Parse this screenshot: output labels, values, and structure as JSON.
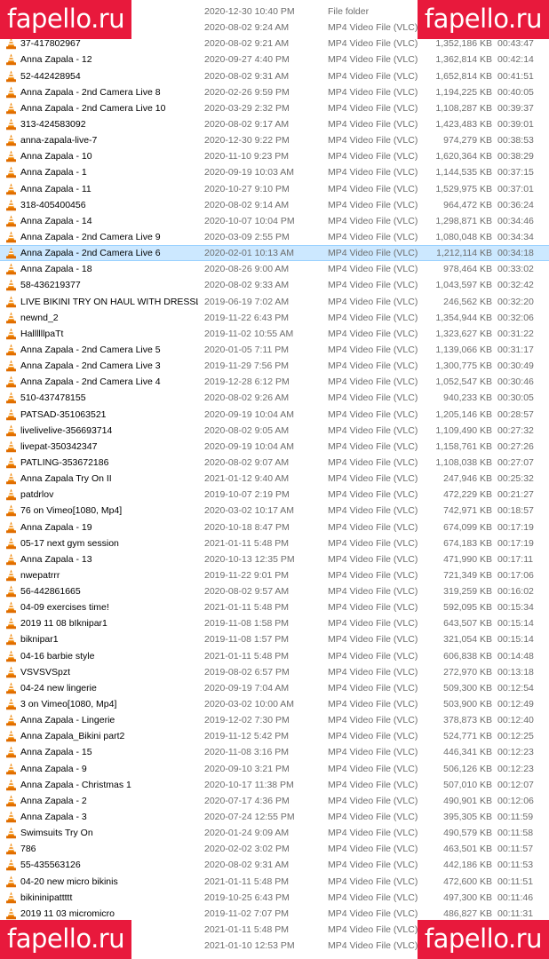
{
  "watermark": "fapello.ru",
  "rows": [
    {
      "name": "",
      "date": "2020-12-30 10:40 PM",
      "type": "File folder",
      "size": "",
      "length": "",
      "folder": true
    },
    {
      "name": "",
      "date": "2020-08-02 9:24 AM",
      "type": "MP4 Video File (VLC)",
      "size": "",
      "length": ""
    },
    {
      "name": "37-417802967",
      "date": "2020-08-02 9:21 AM",
      "type": "MP4 Video File (VLC)",
      "size": "1,352,186 KB",
      "length": "00:43:47"
    },
    {
      "name": "Anna Zapala - 12",
      "date": "2020-09-27 4:40 PM",
      "type": "MP4 Video File (VLC)",
      "size": "1,362,814 KB",
      "length": "00:42:14"
    },
    {
      "name": "52-442428954",
      "date": "2020-08-02 9:31 AM",
      "type": "MP4 Video File (VLC)",
      "size": "1,652,814 KB",
      "length": "00:41:51"
    },
    {
      "name": "Anna Zapala - 2nd Camera Live 8",
      "date": "2020-02-26 9:59 PM",
      "type": "MP4 Video File (VLC)",
      "size": "1,194,225 KB",
      "length": "00:40:05"
    },
    {
      "name": "Anna Zapala - 2nd Camera Live 10",
      "date": "2020-03-29 2:32 PM",
      "type": "MP4 Video File (VLC)",
      "size": "1,108,287 KB",
      "length": "00:39:37"
    },
    {
      "name": "313-424583092",
      "date": "2020-08-02 9:17 AM",
      "type": "MP4 Video File (VLC)",
      "size": "1,423,483 KB",
      "length": "00:39:01"
    },
    {
      "name": "anna-zapala-live-7",
      "date": "2020-12-30 9:22 PM",
      "type": "MP4 Video File (VLC)",
      "size": "974,279 KB",
      "length": "00:38:53"
    },
    {
      "name": "Anna Zapala - 10",
      "date": "2020-11-10 9:23 PM",
      "type": "MP4 Video File (VLC)",
      "size": "1,620,364 KB",
      "length": "00:38:29"
    },
    {
      "name": "Anna Zapala - 1",
      "date": "2020-09-19 10:03 AM",
      "type": "MP4 Video File (VLC)",
      "size": "1,144,535 KB",
      "length": "00:37:15"
    },
    {
      "name": "Anna Zapala - 11",
      "date": "2020-10-27 9:10 PM",
      "type": "MP4 Video File (VLC)",
      "size": "1,529,975 KB",
      "length": "00:37:01"
    },
    {
      "name": "318-405400456",
      "date": "2020-08-02 9:14 AM",
      "type": "MP4 Video File (VLC)",
      "size": "964,472 KB",
      "length": "00:36:24"
    },
    {
      "name": "Anna Zapala - 14",
      "date": "2020-10-07 10:04 PM",
      "type": "MP4 Video File (VLC)",
      "size": "1,298,871 KB",
      "length": "00:34:46"
    },
    {
      "name": "Anna Zapala - 2nd Camera Live 9",
      "date": "2020-03-09 2:55 PM",
      "type": "MP4 Video File (VLC)",
      "size": "1,080,048 KB",
      "length": "00:34:34"
    },
    {
      "name": "Anna Zapala - 2nd Camera Live 6",
      "date": "2020-02-01 10:13 AM",
      "type": "MP4 Video File (VLC)",
      "size": "1,212,114 KB",
      "length": "00:34:18",
      "selected": true
    },
    {
      "name": "Anna Zapala - 18",
      "date": "2020-08-26 9:00 AM",
      "type": "MP4 Video File (VLC)",
      "size": "978,464 KB",
      "length": "00:33:02"
    },
    {
      "name": "58-436219377",
      "date": "2020-08-02 9:33 AM",
      "type": "MP4 Video File (VLC)",
      "size": "1,043,597 KB",
      "length": "00:32:42"
    },
    {
      "name": "LIVE  BIKINI TRY ON HAUL WITH DRESSLI...",
      "date": "2019-06-19 7:02 AM",
      "type": "MP4 Video File (VLC)",
      "size": "246,562 KB",
      "length": "00:32:20"
    },
    {
      "name": "newnd_2",
      "date": "2019-11-22 6:43 PM",
      "type": "MP4 Video File (VLC)",
      "size": "1,354,944 KB",
      "length": "00:32:06"
    },
    {
      "name": "HallllllpaTt",
      "date": "2019-11-02 10:55 AM",
      "type": "MP4 Video File (VLC)",
      "size": "1,323,627 KB",
      "length": "00:31:22"
    },
    {
      "name": "Anna Zapala - 2nd Camera Live 5",
      "date": "2020-01-05 7:11 PM",
      "type": "MP4 Video File (VLC)",
      "size": "1,139,066 KB",
      "length": "00:31:17"
    },
    {
      "name": "Anna Zapala - 2nd Camera Live 3",
      "date": "2019-11-29 7:56 PM",
      "type": "MP4 Video File (VLC)",
      "size": "1,300,775 KB",
      "length": "00:30:49"
    },
    {
      "name": "Anna Zapala - 2nd Camera Live 4",
      "date": "2019-12-28 6:12 PM",
      "type": "MP4 Video File (VLC)",
      "size": "1,052,547 KB",
      "length": "00:30:46"
    },
    {
      "name": "510-437478155",
      "date": "2020-08-02 9:26 AM",
      "type": "MP4 Video File (VLC)",
      "size": "940,233 KB",
      "length": "00:30:05"
    },
    {
      "name": "PATSAD-351063521",
      "date": "2020-09-19 10:04 AM",
      "type": "MP4 Video File (VLC)",
      "size": "1,205,146 KB",
      "length": "00:28:57"
    },
    {
      "name": "livelivelive-356693714",
      "date": "2020-08-02 9:05 AM",
      "type": "MP4 Video File (VLC)",
      "size": "1,109,490 KB",
      "length": "00:27:32"
    },
    {
      "name": "livepat-350342347",
      "date": "2020-09-19 10:04 AM",
      "type": "MP4 Video File (VLC)",
      "size": "1,158,761 KB",
      "length": "00:27:26"
    },
    {
      "name": "PATLING-353672186",
      "date": "2020-08-02 9:07 AM",
      "type": "MP4 Video File (VLC)",
      "size": "1,108,038 KB",
      "length": "00:27:07"
    },
    {
      "name": "Anna Zapala Try On II",
      "date": "2021-01-12 9:40 AM",
      "type": "MP4 Video File (VLC)",
      "size": "247,946 KB",
      "length": "00:25:32"
    },
    {
      "name": "patdrlov",
      "date": "2019-10-07 2:19 PM",
      "type": "MP4 Video File (VLC)",
      "size": "472,229 KB",
      "length": "00:21:27"
    },
    {
      "name": "76 on Vimeo[1080, Mp4]",
      "date": "2020-03-02 10:17 AM",
      "type": "MP4 Video File (VLC)",
      "size": "742,971 KB",
      "length": "00:18:57"
    },
    {
      "name": "Anna Zapala - 19",
      "date": "2020-10-18 8:47 PM",
      "type": "MP4 Video File (VLC)",
      "size": "674,099 KB",
      "length": "00:17:19"
    },
    {
      "name": "05-17 next gym session",
      "date": "2021-01-11 5:48 PM",
      "type": "MP4 Video File (VLC)",
      "size": "674,183 KB",
      "length": "00:17:19"
    },
    {
      "name": "Anna Zapala - 13",
      "date": "2020-10-13 12:35 PM",
      "type": "MP4 Video File (VLC)",
      "size": "471,990 KB",
      "length": "00:17:11"
    },
    {
      "name": "nwepatrrr",
      "date": "2019-11-22 9:01 PM",
      "type": "MP4 Video File (VLC)",
      "size": "721,349 KB",
      "length": "00:17:06"
    },
    {
      "name": "56-442861665",
      "date": "2020-08-02 9:57 AM",
      "type": "MP4 Video File (VLC)",
      "size": "319,259 KB",
      "length": "00:16:02"
    },
    {
      "name": "04-09 exercises time!",
      "date": "2021-01-11 5:48 PM",
      "type": "MP4 Video File (VLC)",
      "size": "592,095 KB",
      "length": "00:15:34"
    },
    {
      "name": "2019 11 08 bIknipar1",
      "date": "2019-11-08 1:58 PM",
      "type": "MP4 Video File (VLC)",
      "size": "643,507 KB",
      "length": "00:15:14"
    },
    {
      "name": "biknipar1",
      "date": "2019-11-08 1:57 PM",
      "type": "MP4 Video File (VLC)",
      "size": "321,054 KB",
      "length": "00:15:14"
    },
    {
      "name": "04-16 barbie style",
      "date": "2021-01-11 5:48 PM",
      "type": "MP4 Video File (VLC)",
      "size": "606,838 KB",
      "length": "00:14:48"
    },
    {
      "name": "VSVSVSpzt",
      "date": "2019-08-02 6:57 PM",
      "type": "MP4 Video File (VLC)",
      "size": "272,970 KB",
      "length": "00:13:18"
    },
    {
      "name": "04-24 new lingerie",
      "date": "2020-09-19 7:04 AM",
      "type": "MP4 Video File (VLC)",
      "size": "509,300 KB",
      "length": "00:12:54"
    },
    {
      "name": "3 on Vimeo[1080, Mp4]",
      "date": "2020-03-02 10:00 AM",
      "type": "MP4 Video File (VLC)",
      "size": "503,900 KB",
      "length": "00:12:49"
    },
    {
      "name": "Anna Zapala - Lingerie",
      "date": "2019-12-02 7:30 PM",
      "type": "MP4 Video File (VLC)",
      "size": "378,873 KB",
      "length": "00:12:40"
    },
    {
      "name": "Anna Zapala_Bikini part2",
      "date": "2019-11-12 5:42 PM",
      "type": "MP4 Video File (VLC)",
      "size": "524,771 KB",
      "length": "00:12:25"
    },
    {
      "name": "Anna Zapala - 15",
      "date": "2020-11-08 3:16 PM",
      "type": "MP4 Video File (VLC)",
      "size": "446,341 KB",
      "length": "00:12:23"
    },
    {
      "name": "Anna Zapala - 9",
      "date": "2020-09-10 3:21 PM",
      "type": "MP4 Video File (VLC)",
      "size": "506,126 KB",
      "length": "00:12:23"
    },
    {
      "name": "Anna Zapala - Christmas 1",
      "date": "2020-10-17 11:38 PM",
      "type": "MP4 Video File (VLC)",
      "size": "507,010 KB",
      "length": "00:12:07"
    },
    {
      "name": "Anna Zapala - 2",
      "date": "2020-07-17 4:36 PM",
      "type": "MP4 Video File (VLC)",
      "size": "490,901 KB",
      "length": "00:12:06"
    },
    {
      "name": "Anna Zapala - 3",
      "date": "2020-07-24 12:55 PM",
      "type": "MP4 Video File (VLC)",
      "size": "395,305 KB",
      "length": "00:11:59"
    },
    {
      "name": "Swimsuits Try On",
      "date": "2020-01-24 9:09 AM",
      "type": "MP4 Video File (VLC)",
      "size": "490,579 KB",
      "length": "00:11:58"
    },
    {
      "name": "786",
      "date": "2020-02-02 3:02 PM",
      "type": "MP4 Video File (VLC)",
      "size": "463,501 KB",
      "length": "00:11:57"
    },
    {
      "name": "55-435563126",
      "date": "2020-08-02 9:31 AM",
      "type": "MP4 Video File (VLC)",
      "size": "442,186 KB",
      "length": "00:11:53"
    },
    {
      "name": "04-20 new micro bikinis",
      "date": "2021-01-11 5:48 PM",
      "type": "MP4 Video File (VLC)",
      "size": "472,600 KB",
      "length": "00:11:51"
    },
    {
      "name": "bikininipattttt",
      "date": "2019-10-25 6:43 PM",
      "type": "MP4 Video File (VLC)",
      "size": "497,300 KB",
      "length": "00:11:46"
    },
    {
      "name": "2019 11 03 micromicro",
      "date": "2019-11-02 7:07 PM",
      "type": "MP4 Video File (VLC)",
      "size": "486,827 KB",
      "length": "00:11:31"
    },
    {
      "name": "",
      "date": "2021-01-11 5:48 PM",
      "type": "MP4 Video File (VLC)",
      "size": "",
      "length": ""
    },
    {
      "name": "",
      "date": "2021-01-10 12:53 PM",
      "type": "MP4 Video File (VLC)",
      "size": "",
      "length": ""
    }
  ]
}
